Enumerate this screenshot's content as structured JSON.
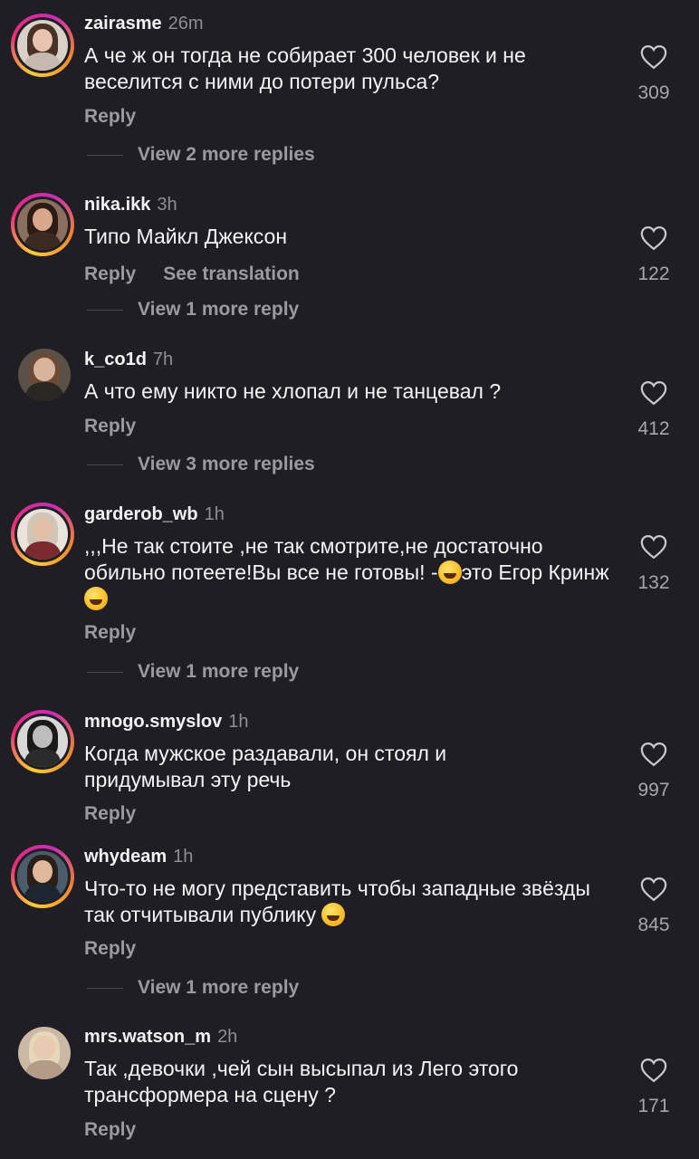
{
  "labels": {
    "reply": "Reply",
    "see_translation": "See translation"
  },
  "comments": [
    {
      "username": "zairasme",
      "time": "26m",
      "text": "А че ж он тогда не собирает 300 человек и не веселится с ними до потери пульса?",
      "likes": "309",
      "view_more": "View 2 more replies"
    },
    {
      "username": "nika.ikk",
      "time": "3h",
      "text": "Типо Майкл Джексон",
      "likes": "122",
      "view_more": "View 1 more reply"
    },
    {
      "username": "k_co1d",
      "time": "7h",
      "text": "А что ему никто не хлопал и не танцевал ?",
      "likes": "412",
      "view_more": "View 3 more replies"
    },
    {
      "username": "garderob_wb",
      "time": "1h",
      "text_line1": ",,,Не так стоите ,не так смотрите,не достаточно обильно потеете!Вы все не готовы!",
      "text_dash": "-",
      "text_middle": "это Егор Кринж",
      "emoji": "rolling-on-floor-laughing",
      "likes": "132",
      "view_more": "View 1 more reply"
    },
    {
      "username": "mnogo.smyslov",
      "time": "1h",
      "text": "Когда мужское раздавали, он стоял и придумывал эту речь",
      "likes": "997"
    },
    {
      "username": "whydeam",
      "time": "1h",
      "text": "Что-то не могу представить чтобы западные звёзды так отчитывали публику",
      "emoji": "face-with-tears-of-joy",
      "likes": "845",
      "view_more": "View 1 more reply"
    },
    {
      "username": "mrs.watson_m",
      "time": "2h",
      "text": "Так ,девочки ,чей сын высыпал из Лего этого трансформера на сцену ?",
      "likes": "171"
    }
  ],
  "colors": {
    "background": "#1f1e24",
    "secondary_text": "#9a9a9f",
    "story_ring": [
      "#f9ce34",
      "#ee2a7b",
      "#c92bb6"
    ]
  }
}
